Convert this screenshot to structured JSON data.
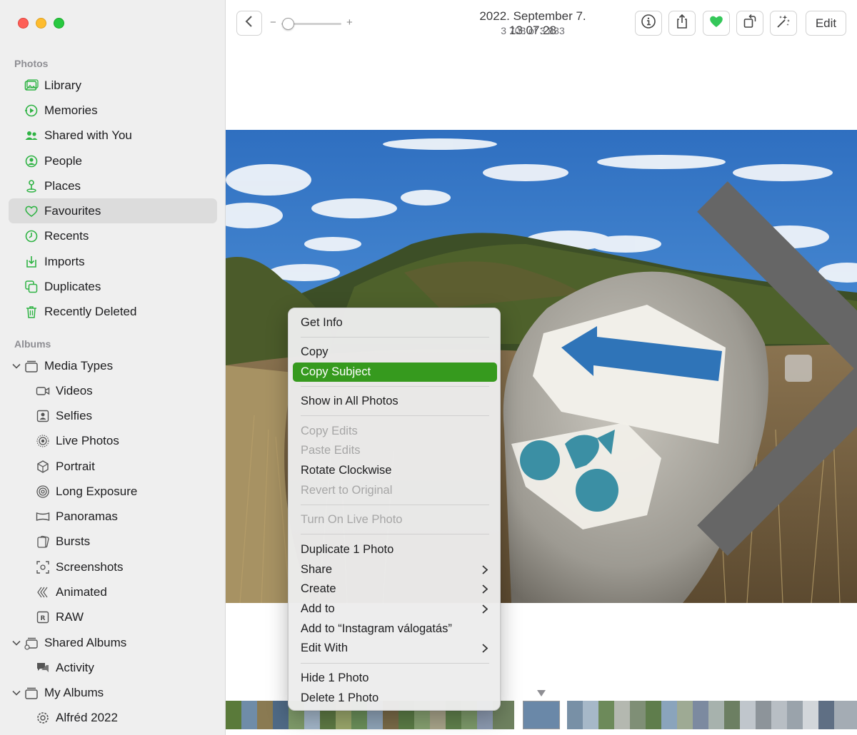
{
  "sidebar": {
    "photos_header": "Photos",
    "albums_header": "Albums",
    "items": [
      {
        "label": "Library",
        "icon": "library-icon"
      },
      {
        "label": "Memories",
        "icon": "memories-icon"
      },
      {
        "label": "Shared with You",
        "icon": "shared-with-you-icon"
      },
      {
        "label": "People",
        "icon": "people-icon"
      },
      {
        "label": "Places",
        "icon": "places-icon"
      },
      {
        "label": "Favourites",
        "icon": "heart-icon",
        "selected": true
      },
      {
        "label": "Recents",
        "icon": "clock-icon"
      },
      {
        "label": "Imports",
        "icon": "import-icon"
      },
      {
        "label": "Duplicates",
        "icon": "duplicates-icon"
      },
      {
        "label": "Recently Deleted",
        "icon": "trash-icon"
      }
    ],
    "albums": [
      {
        "label": "Media Types",
        "icon": "stack-icon"
      },
      {
        "label": "Videos",
        "icon": "video-icon"
      },
      {
        "label": "Selfies",
        "icon": "selfie-icon"
      },
      {
        "label": "Live Photos",
        "icon": "live-photo-icon"
      },
      {
        "label": "Portrait",
        "icon": "portrait-icon"
      },
      {
        "label": "Long Exposure",
        "icon": "long-exposure-icon"
      },
      {
        "label": "Panoramas",
        "icon": "panorama-icon"
      },
      {
        "label": "Bursts",
        "icon": "bursts-icon"
      },
      {
        "label": "Screenshots",
        "icon": "screenshot-icon"
      },
      {
        "label": "Animated",
        "icon": "animated-icon"
      },
      {
        "label": "RAW",
        "icon": "raw-icon"
      },
      {
        "label": "Shared Albums",
        "icon": "shared-albums-icon"
      },
      {
        "label": "Activity",
        "icon": "activity-icon"
      },
      {
        "label": "My Albums",
        "icon": "stack-icon"
      },
      {
        "label": "Alfréd 2022",
        "icon": "smart-album-gear-icon"
      }
    ]
  },
  "toolbar": {
    "title": "2022. September 7. 13:07:28",
    "subtitle": "3 708 of 3 833",
    "zoom_minus": "−",
    "zoom_plus": "+",
    "edit_label": "Edit",
    "favourite_color": "#34c759"
  },
  "context_menu": {
    "items": [
      {
        "label": "Get Info"
      },
      {
        "label": "Copy"
      },
      {
        "label": "Copy Subject",
        "highlighted": true
      },
      {
        "label": "Show in All Photos"
      },
      {
        "label": "Copy Edits",
        "disabled": true
      },
      {
        "label": "Paste Edits",
        "disabled": true
      },
      {
        "label": "Rotate Clockwise"
      },
      {
        "label": "Revert to Original",
        "disabled": true
      },
      {
        "label": "Turn On Live Photo",
        "disabled": true
      },
      {
        "label": "Duplicate 1 Photo"
      },
      {
        "label": "Share",
        "submenu": true
      },
      {
        "label": "Create",
        "submenu": true
      },
      {
        "label": "Add to",
        "submenu": true
      },
      {
        "label": "Add to “Instagram válogatás”"
      },
      {
        "label": "Edit With",
        "submenu": true
      },
      {
        "label": "Hide 1 Photo"
      },
      {
        "label": "Delete 1 Photo"
      }
    ],
    "highlight_color": "#369a1e"
  }
}
